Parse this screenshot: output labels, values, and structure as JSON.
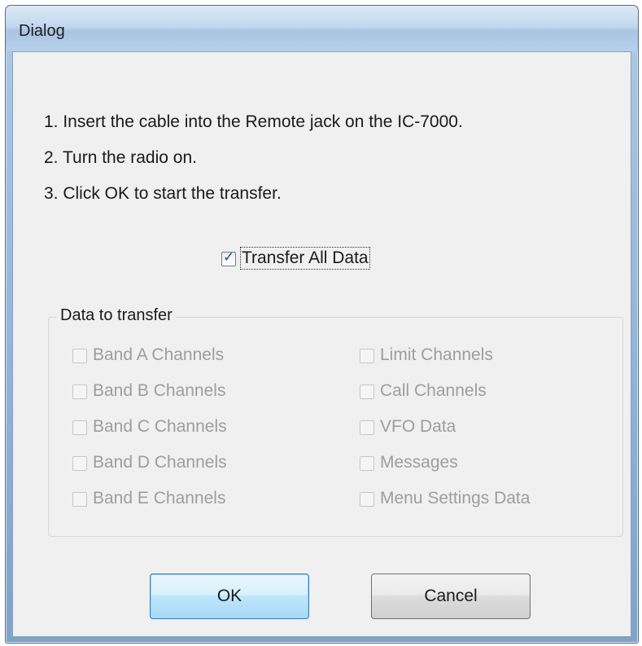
{
  "window": {
    "title": "Dialog"
  },
  "instructions": [
    "1. Insert the cable into the Remote jack on the IC-7000.",
    "2. Turn the radio on.",
    "3. Click OK to start the transfer."
  ],
  "transfer_all": {
    "label": "Transfer All Data",
    "checked": true
  },
  "group": {
    "legend": "Data to transfer",
    "left_items": [
      {
        "label": "Band A Channels",
        "checked": false,
        "enabled": false
      },
      {
        "label": "Band B Channels",
        "checked": false,
        "enabled": false
      },
      {
        "label": "Band C Channels",
        "checked": false,
        "enabled": false
      },
      {
        "label": "Band D Channels",
        "checked": false,
        "enabled": false
      },
      {
        "label": "Band E Channels",
        "checked": false,
        "enabled": false
      }
    ],
    "right_items": [
      {
        "label": "Limit Channels",
        "checked": false,
        "enabled": false
      },
      {
        "label": "Call Channels",
        "checked": false,
        "enabled": false
      },
      {
        "label": "VFO Data",
        "checked": false,
        "enabled": false
      },
      {
        "label": "Messages",
        "checked": false,
        "enabled": false
      },
      {
        "label": "Menu Settings Data",
        "checked": false,
        "enabled": false
      }
    ]
  },
  "buttons": {
    "ok": "OK",
    "cancel": "Cancel"
  },
  "icons": {
    "check": "checkmark-icon"
  }
}
